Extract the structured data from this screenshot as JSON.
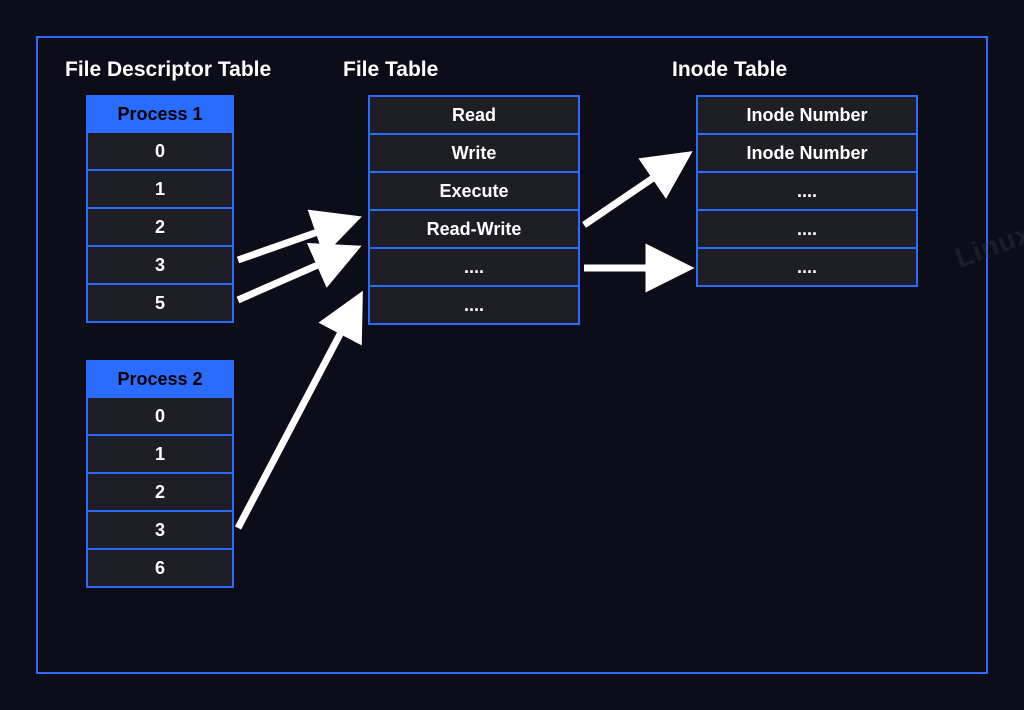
{
  "titles": {
    "fd": "File Descriptor Table",
    "file": "File Table",
    "inode": "Inode Table"
  },
  "process1": {
    "header": "Process 1",
    "rows": [
      "0",
      "1",
      "2",
      "3",
      "5"
    ]
  },
  "process2": {
    "header": "Process 2",
    "rows": [
      "0",
      "1",
      "2",
      "3",
      "6"
    ]
  },
  "fileTable": {
    "rows": [
      "Read",
      "Write",
      "Execute",
      "Read-Write",
      "....",
      "...."
    ]
  },
  "inodeTable": {
    "rows": [
      "Inode Number",
      "Inode Number",
      "....",
      "....",
      "...."
    ]
  },
  "watermark": "Linux"
}
